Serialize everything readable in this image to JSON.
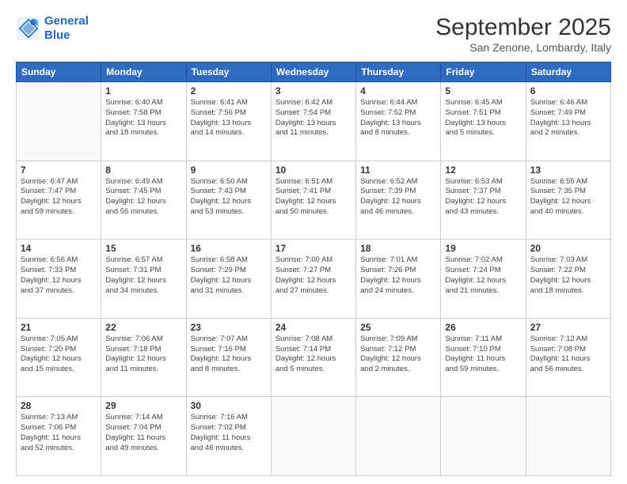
{
  "logo": {
    "line1": "General",
    "line2": "Blue"
  },
  "title": "September 2025",
  "location": "San Zenone, Lombardy, Italy",
  "headers": [
    "Sunday",
    "Monday",
    "Tuesday",
    "Wednesday",
    "Thursday",
    "Friday",
    "Saturday"
  ],
  "weeks": [
    [
      {
        "day": "",
        "text": ""
      },
      {
        "day": "1",
        "text": "Sunrise: 6:40 AM\nSunset: 7:58 PM\nDaylight: 13 hours\nand 18 minutes."
      },
      {
        "day": "2",
        "text": "Sunrise: 6:41 AM\nSunset: 7:56 PM\nDaylight: 13 hours\nand 14 minutes."
      },
      {
        "day": "3",
        "text": "Sunrise: 6:42 AM\nSunset: 7:54 PM\nDaylight: 13 hours\nand 11 minutes."
      },
      {
        "day": "4",
        "text": "Sunrise: 6:44 AM\nSunset: 7:52 PM\nDaylight: 13 hours\nand 8 minutes."
      },
      {
        "day": "5",
        "text": "Sunrise: 6:45 AM\nSunset: 7:51 PM\nDaylight: 13 hours\nand 5 minutes."
      },
      {
        "day": "6",
        "text": "Sunrise: 6:46 AM\nSunset: 7:49 PM\nDaylight: 13 hours\nand 2 minutes."
      }
    ],
    [
      {
        "day": "7",
        "text": "Sunrise: 6:47 AM\nSunset: 7:47 PM\nDaylight: 12 hours\nand 59 minutes."
      },
      {
        "day": "8",
        "text": "Sunrise: 6:49 AM\nSunset: 7:45 PM\nDaylight: 12 hours\nand 56 minutes."
      },
      {
        "day": "9",
        "text": "Sunrise: 6:50 AM\nSunset: 7:43 PM\nDaylight: 12 hours\nand 53 minutes."
      },
      {
        "day": "10",
        "text": "Sunrise: 6:51 AM\nSunset: 7:41 PM\nDaylight: 12 hours\nand 50 minutes."
      },
      {
        "day": "11",
        "text": "Sunrise: 6:52 AM\nSunset: 7:39 PM\nDaylight: 12 hours\nand 46 minutes."
      },
      {
        "day": "12",
        "text": "Sunrise: 6:53 AM\nSunset: 7:37 PM\nDaylight: 12 hours\nand 43 minutes."
      },
      {
        "day": "13",
        "text": "Sunrise: 6:55 AM\nSunset: 7:35 PM\nDaylight: 12 hours\nand 40 minutes."
      }
    ],
    [
      {
        "day": "14",
        "text": "Sunrise: 6:56 AM\nSunset: 7:33 PM\nDaylight: 12 hours\nand 37 minutes."
      },
      {
        "day": "15",
        "text": "Sunrise: 6:57 AM\nSunset: 7:31 PM\nDaylight: 12 hours\nand 34 minutes."
      },
      {
        "day": "16",
        "text": "Sunrise: 6:58 AM\nSunset: 7:29 PM\nDaylight: 12 hours\nand 31 minutes."
      },
      {
        "day": "17",
        "text": "Sunrise: 7:00 AM\nSunset: 7:27 PM\nDaylight: 12 hours\nand 27 minutes."
      },
      {
        "day": "18",
        "text": "Sunrise: 7:01 AM\nSunset: 7:26 PM\nDaylight: 12 hours\nand 24 minutes."
      },
      {
        "day": "19",
        "text": "Sunrise: 7:02 AM\nSunset: 7:24 PM\nDaylight: 12 hours\nand 21 minutes."
      },
      {
        "day": "20",
        "text": "Sunrise: 7:03 AM\nSunset: 7:22 PM\nDaylight: 12 hours\nand 18 minutes."
      }
    ],
    [
      {
        "day": "21",
        "text": "Sunrise: 7:05 AM\nSunset: 7:20 PM\nDaylight: 12 hours\nand 15 minutes."
      },
      {
        "day": "22",
        "text": "Sunrise: 7:06 AM\nSunset: 7:18 PM\nDaylight: 12 hours\nand 11 minutes."
      },
      {
        "day": "23",
        "text": "Sunrise: 7:07 AM\nSunset: 7:16 PM\nDaylight: 12 hours\nand 8 minutes."
      },
      {
        "day": "24",
        "text": "Sunrise: 7:08 AM\nSunset: 7:14 PM\nDaylight: 12 hours\nand 5 minutes."
      },
      {
        "day": "25",
        "text": "Sunrise: 7:09 AM\nSunset: 7:12 PM\nDaylight: 12 hours\nand 2 minutes."
      },
      {
        "day": "26",
        "text": "Sunrise: 7:11 AM\nSunset: 7:10 PM\nDaylight: 11 hours\nand 59 minutes."
      },
      {
        "day": "27",
        "text": "Sunrise: 7:12 AM\nSunset: 7:08 PM\nDaylight: 11 hours\nand 56 minutes."
      }
    ],
    [
      {
        "day": "28",
        "text": "Sunrise: 7:13 AM\nSunset: 7:06 PM\nDaylight: 11 hours\nand 52 minutes."
      },
      {
        "day": "29",
        "text": "Sunrise: 7:14 AM\nSunset: 7:04 PM\nDaylight: 11 hours\nand 49 minutes."
      },
      {
        "day": "30",
        "text": "Sunrise: 7:16 AM\nSunset: 7:02 PM\nDaylight: 11 hours\nand 46 minutes."
      },
      {
        "day": "",
        "text": ""
      },
      {
        "day": "",
        "text": ""
      },
      {
        "day": "",
        "text": ""
      },
      {
        "day": "",
        "text": ""
      }
    ]
  ]
}
